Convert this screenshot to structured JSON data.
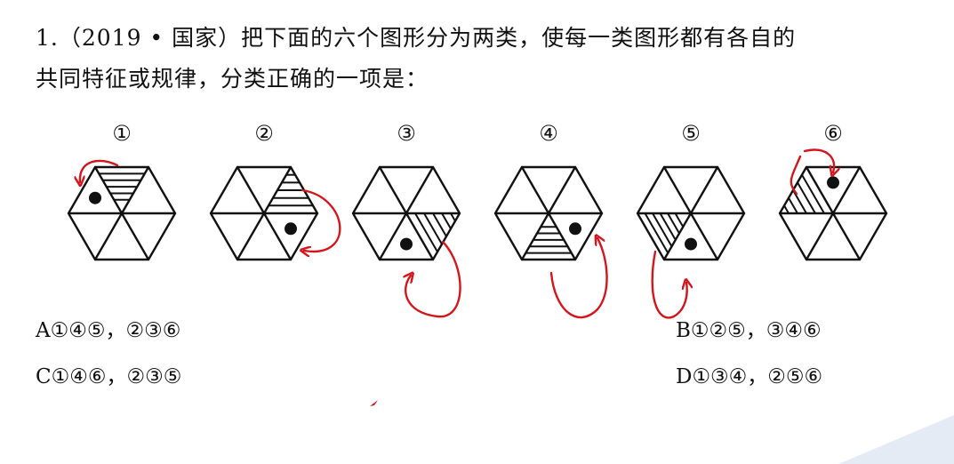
{
  "question": {
    "line1": "1.（2019 • 国家）把下面的六个图形分为两类，使每一类图形都有各自的",
    "line2": "共同特征或规律，分类正确的一项是："
  },
  "figures": [
    {
      "label": "①"
    },
    {
      "label": "②"
    },
    {
      "label": "③"
    },
    {
      "label": "④"
    },
    {
      "label": "⑤"
    },
    {
      "label": "⑥"
    }
  ],
  "options": {
    "a": "A①④⑤，②③⑥",
    "b": "B①②⑤，③④⑥",
    "c": "C①④⑥，②③⑤",
    "d": "D①③④，②⑤⑥"
  },
  "colors": {
    "annotation": "#d4161c",
    "ink": "#111111"
  }
}
